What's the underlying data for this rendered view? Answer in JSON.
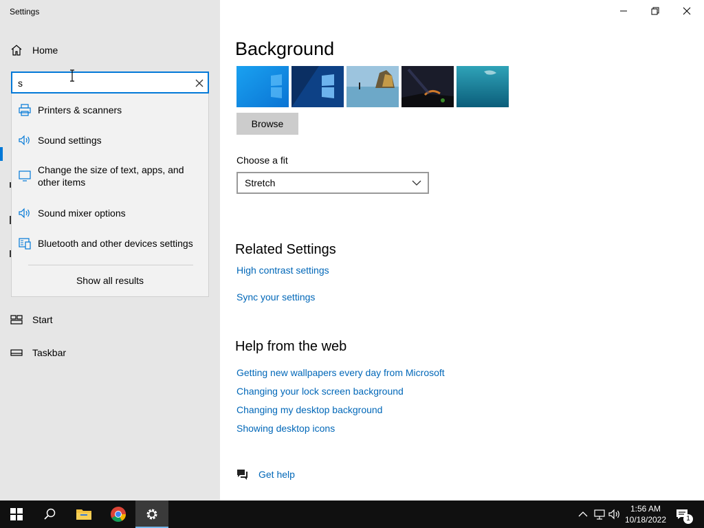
{
  "window": {
    "title": "Settings"
  },
  "sidebar": {
    "home_label": "Home",
    "items": [
      {
        "label": "Start",
        "icon": "start-layout-icon"
      },
      {
        "label": "Taskbar",
        "icon": "taskbar-icon"
      }
    ]
  },
  "search": {
    "value": "s",
    "placeholder": "Find a setting",
    "suggestions": [
      {
        "label": "Printers & scanners",
        "icon": "printer-icon"
      },
      {
        "label": "Sound settings",
        "icon": "speaker-icon"
      },
      {
        "label": "Change the size of text, apps, and other items",
        "icon": "monitor-icon"
      },
      {
        "label": "Sound mixer options",
        "icon": "speaker-icon"
      },
      {
        "label": "Bluetooth and other devices settings",
        "icon": "devices-icon"
      }
    ],
    "show_all": "Show all results"
  },
  "main": {
    "heading": "Background",
    "browse_label": "Browse",
    "fit_label": "Choose a fit",
    "fit_value": "Stretch",
    "related_heading": "Related Settings",
    "related_links": [
      "High contrast settings",
      "Sync your settings"
    ],
    "help_heading": "Help from the web",
    "help_links": [
      "Getting new wallpapers every day from Microsoft",
      "Changing your lock screen background",
      "Changing my desktop background",
      "Showing desktop icons"
    ],
    "get_help": "Get help"
  },
  "colors": {
    "accent": "#0078d7",
    "link": "#0067b8",
    "sidebar_bg": "#e6e6e6",
    "taskbar_bg": "#101010"
  },
  "taskbar": {
    "time": "1:56 AM",
    "date": "10/18/2022",
    "notification_count": "1"
  }
}
